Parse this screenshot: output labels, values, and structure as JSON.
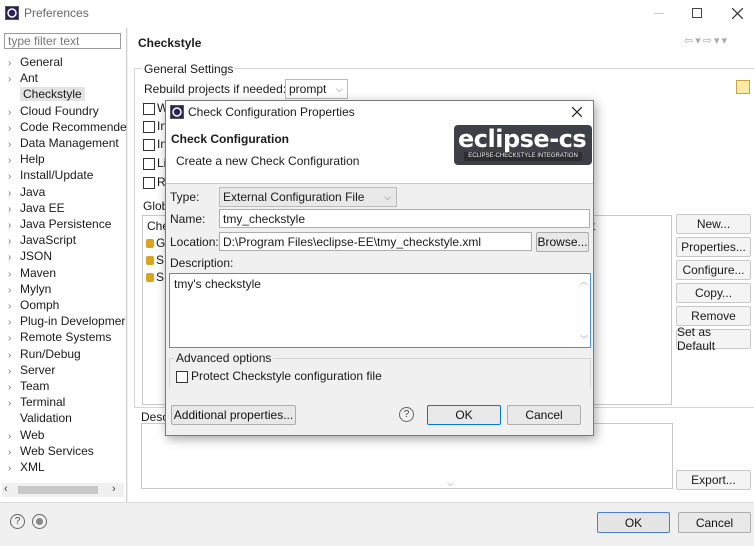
{
  "window": {
    "title": "Preferences",
    "min_icon": "minimize-icon",
    "max_icon": "maximize-icon",
    "close_icon": "close-icon"
  },
  "filter": {
    "placeholder": "type filter text"
  },
  "tree": [
    {
      "label": "General",
      "arrow": "›"
    },
    {
      "label": "Ant",
      "arrow": "›"
    },
    {
      "label": "Checkstyle",
      "arrow": "",
      "selected": true
    },
    {
      "label": "Cloud Foundry",
      "arrow": "›"
    },
    {
      "label": "Code Recommende",
      "arrow": "›"
    },
    {
      "label": "Data Management",
      "arrow": "›"
    },
    {
      "label": "Help",
      "arrow": "›"
    },
    {
      "label": "Install/Update",
      "arrow": "›"
    },
    {
      "label": "Java",
      "arrow": "›"
    },
    {
      "label": "Java EE",
      "arrow": "›"
    },
    {
      "label": "Java Persistence",
      "arrow": "›"
    },
    {
      "label": "JavaScript",
      "arrow": "›"
    },
    {
      "label": "JSON",
      "arrow": "›"
    },
    {
      "label": "Maven",
      "arrow": "›"
    },
    {
      "label": "Mylyn",
      "arrow": "›"
    },
    {
      "label": "Oomph",
      "arrow": "›"
    },
    {
      "label": "Plug-in Developmer",
      "arrow": "›"
    },
    {
      "label": "Remote Systems",
      "arrow": "›"
    },
    {
      "label": "Run/Debug",
      "arrow": "›"
    },
    {
      "label": "Server",
      "arrow": "›"
    },
    {
      "label": "Team",
      "arrow": "›"
    },
    {
      "label": "Terminal",
      "arrow": "›"
    },
    {
      "label": "Validation",
      "arrow": ""
    },
    {
      "label": "Web",
      "arrow": "›"
    },
    {
      "label": "Web Services",
      "arrow": "›"
    },
    {
      "label": "XML",
      "arrow": "›"
    }
  ],
  "page": {
    "title": "Checkstyle",
    "general_settings": "General Settings",
    "rebuild_label": "Rebuild projects if needed:",
    "rebuild_value": "prompt",
    "checkbox_letters": [
      "W",
      "In",
      "In",
      "Li",
      "R"
    ],
    "global_label": "Glob",
    "table_header_left": "Che",
    "table_header_right": "t",
    "table_rows": [
      "G",
      "S",
      "S"
    ],
    "desc_label": "Desc",
    "side_buttons": [
      "New...",
      "Properties...",
      "Configure...",
      "Copy...",
      "Remove",
      "Set as Default"
    ],
    "export": "Export..."
  },
  "footer": {
    "ok": "OK",
    "cancel": "Cancel"
  },
  "dialog": {
    "title": "Check Configuration Properties",
    "heading": "Check Configuration",
    "subheading": "Create a new Check Configuration",
    "logo_main": "eclipse-cs",
    "logo_sub": "ECLIPSE-CHECKSTYLE INTEGRATION",
    "type_label": "Type:",
    "type_value": "External Configuration File",
    "name_label": "Name:",
    "name_value": "tmy_checkstyle",
    "location_label": "Location:",
    "location_value": "D:\\Program Files\\eclipse-EE\\tmy_checkstyle.xml",
    "browse": "Browse...",
    "description_label": "Description:",
    "description_value": "tmy's checkstyle",
    "advanced": "Advanced options",
    "protect": "Protect Checkstyle configuration file",
    "additional": "Additional properties...",
    "ok": "OK",
    "cancel": "Cancel"
  }
}
